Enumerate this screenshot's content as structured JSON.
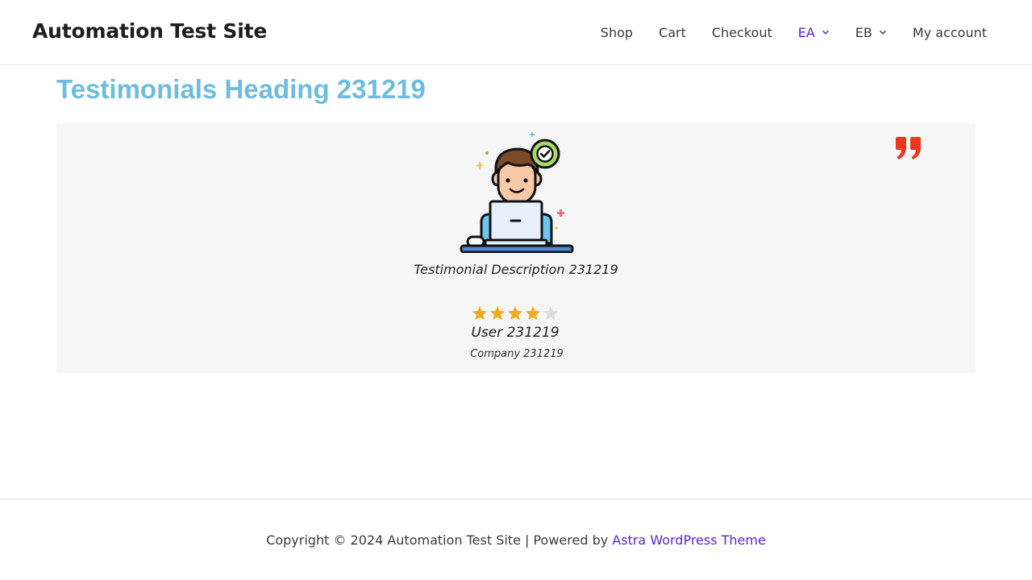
{
  "header": {
    "site_title": "Automation Test Site",
    "nav": [
      {
        "label": "Shop"
      },
      {
        "label": "Cart"
      },
      {
        "label": "Checkout"
      },
      {
        "label": "EA",
        "dropdown": true,
        "active": true
      },
      {
        "label": "EB",
        "dropdown": true
      },
      {
        "label": "My account"
      }
    ]
  },
  "main": {
    "heading": "Testimonials Heading 231219",
    "testimonial": {
      "quote_icon": "quote-right-icon",
      "avatar_icon": "developer-avatar-icon",
      "description": "Testimonial Description 231219",
      "rating": 4,
      "rating_max": 5,
      "user": "User 231219",
      "company": "Company 231219"
    }
  },
  "footer": {
    "copyright_prefix": "Copyright © 2024 Automation Test Site | Powered by ",
    "link_label": "Astra WordPress Theme"
  },
  "colors": {
    "accent": "#5b1ed8",
    "heading": "#6ebce0",
    "quote": "#e8391f",
    "star_filled": "#f0ac1e",
    "star_empty": "#dcdcdc",
    "card_bg": "#f6f6f6"
  }
}
